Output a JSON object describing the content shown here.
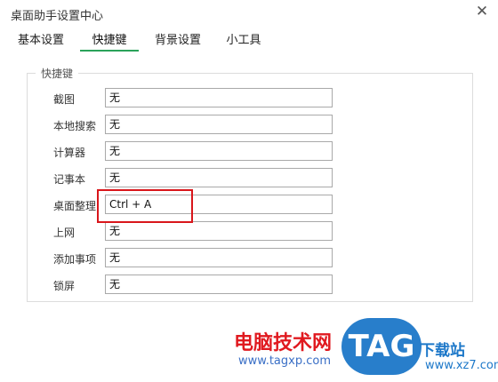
{
  "window": {
    "title": "桌面助手设置中心",
    "close_glyph": "✕"
  },
  "tabs": [
    {
      "label": "基本设置",
      "active": false
    },
    {
      "label": "快捷键",
      "active": true
    },
    {
      "label": "背景设置",
      "active": false
    },
    {
      "label": "小工具",
      "active": false
    }
  ],
  "shortcuts": {
    "group_title": "快捷键",
    "rows": [
      {
        "label": "截图",
        "value": "无"
      },
      {
        "label": "本地搜索",
        "value": "无"
      },
      {
        "label": "计算器",
        "value": "无"
      },
      {
        "label": "记事本",
        "value": "无"
      },
      {
        "label": "桌面整理",
        "value": "Ctrl + A"
      },
      {
        "label": "上网",
        "value": "无"
      },
      {
        "label": "添加事项",
        "value": "无"
      },
      {
        "label": "锁屏",
        "value": "无"
      }
    ]
  },
  "watermark": {
    "name": "电脑技术网",
    "url": "www.tagxp.com",
    "logo_text": "TAG",
    "site_name": "下载站",
    "site_url": "www.xz7.com"
  },
  "colors": {
    "accent": "#2aa35a",
    "highlight": "#d9161b"
  }
}
